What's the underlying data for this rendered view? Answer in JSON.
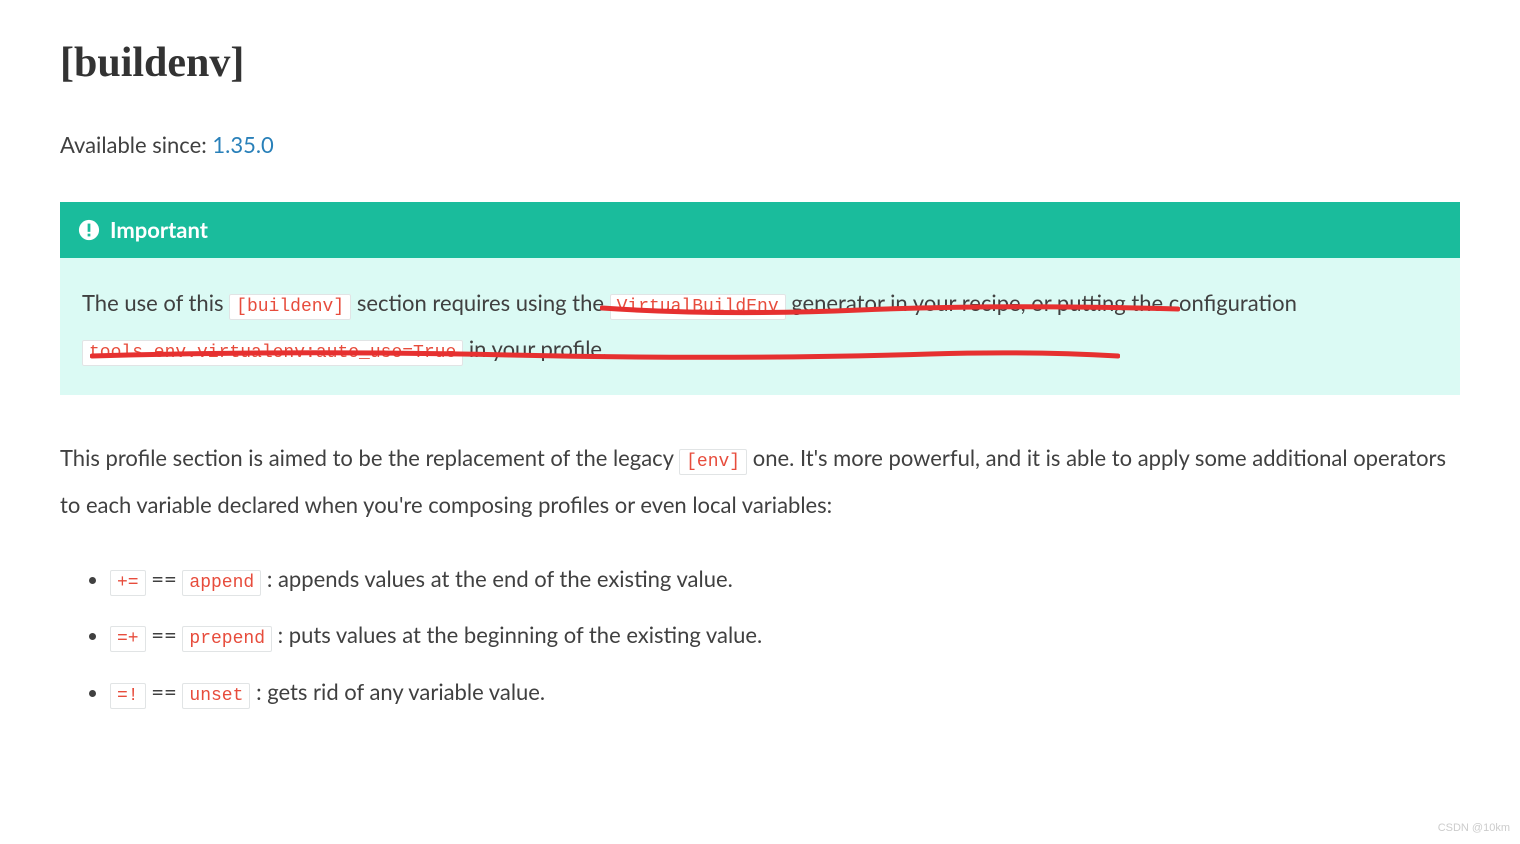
{
  "heading": "[buildenv]",
  "availability": {
    "label": "Available since: ",
    "version": "1.35.0"
  },
  "admonition": {
    "title": "Important",
    "body_parts": {
      "t1": "The use of this ",
      "code1": "[buildenv]",
      "t2": " section requires using the ",
      "code2": "VirtualBuildEnv",
      "t3": " generator in your recipe, or putting the configuration ",
      "code3": "tools.env.virtualenv:auto_use=True",
      "t4": " in your profile."
    }
  },
  "description": {
    "t1": "This profile section is aimed to be the replacement of the legacy ",
    "code1": "[env]",
    "t2": " one. It's more powerful, and it is able to apply some additional operators to each variable declared when you're composing profiles or even local variables:"
  },
  "operators": [
    {
      "op": "+=",
      "eq": " == ",
      "name": "append",
      "desc": ": appends values at the end of the existing value."
    },
    {
      "op": "=+",
      "eq": " == ",
      "name": "prepend",
      "desc": ": puts values at the beginning of the existing value."
    },
    {
      "op": "=!",
      "eq": " == ",
      "name": "unset",
      "desc": ": gets rid of any variable value."
    }
  ],
  "watermark": "CSDN @10km"
}
